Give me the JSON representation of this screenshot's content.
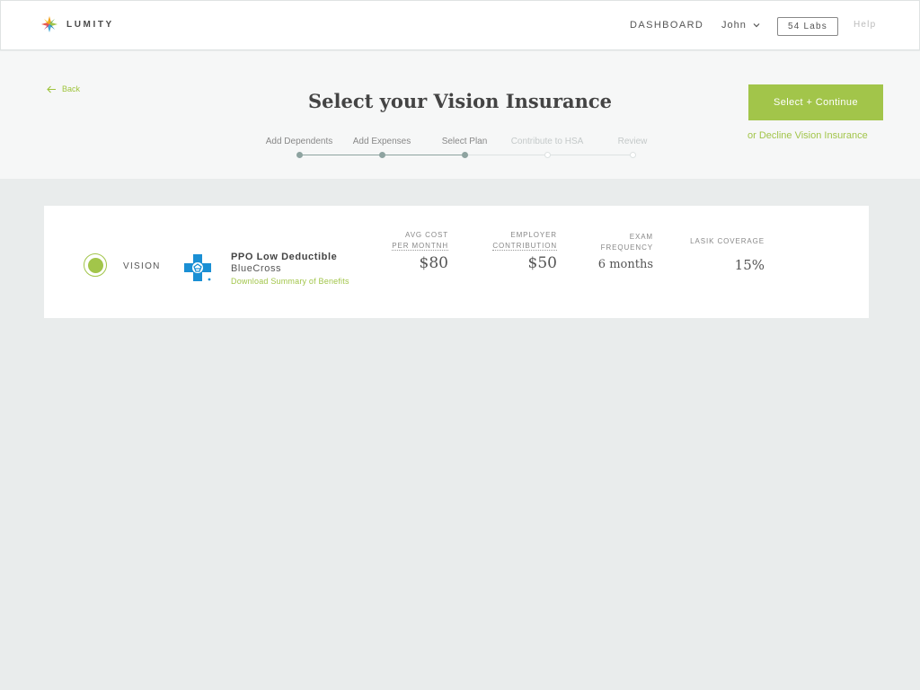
{
  "nav": {
    "brand": "LUMITY",
    "dashboard": "DASHBOARD",
    "user": "John",
    "company": "54 Labs",
    "help": "Help"
  },
  "header": {
    "back": "Back",
    "title": "Select your Vision Insurance",
    "continue": "Select + Continue",
    "decline": "or Decline Vision Insurance"
  },
  "steps": [
    {
      "label": "Add Dependents",
      "state": "done"
    },
    {
      "label": "Add Expenses",
      "state": "done"
    },
    {
      "label": "Select Plan",
      "state": "current"
    },
    {
      "label": "Contribute to HSA",
      "state": "todo"
    },
    {
      "label": "Review",
      "state": "todo"
    }
  ],
  "plan": {
    "selected": true,
    "category": "VISION",
    "name": "PPO Low Deductible",
    "carrier": "BlueCross",
    "sob_link": "Download Summary of Benefits",
    "metrics": [
      {
        "label_1": "AVG COST",
        "label_2": "PER MONTNH",
        "value": "$80"
      },
      {
        "label_1": "EMPLOYER",
        "label_2": "CONTRIBUTION",
        "value": "$50"
      },
      {
        "label_1": "EXAM",
        "label_2": "FREQUENCY",
        "value": "6 months"
      },
      {
        "label_1": "LASIK COVERAGE",
        "label_2": "",
        "value": "15%"
      }
    ]
  },
  "colors": {
    "accent": "#a2c54a",
    "step_done": "#8ea3a0",
    "bluecross": "#1a8fd4",
    "page_bg": "#e9ecec"
  }
}
